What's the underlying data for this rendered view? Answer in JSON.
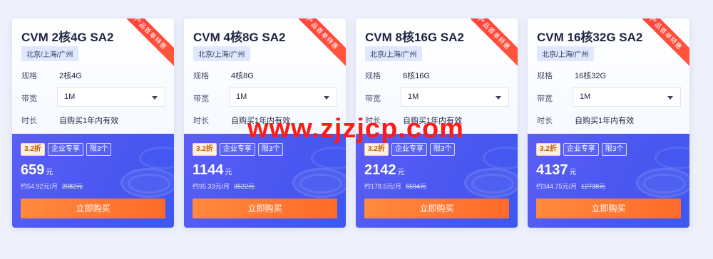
{
  "ribbon_label": "产品首单特惠",
  "labels": {
    "spec": "规格",
    "bandwidth": "带宽",
    "duration": "时长"
  },
  "buy_label": "立即购买",
  "currency_unit": "元",
  "cards": [
    {
      "title": "CVM 2核4G SA2",
      "region": "北京/上海/广州",
      "spec": "2核4G",
      "bandwidth": "1M",
      "duration": "自购买1年内有效",
      "tags": [
        "3.2折",
        "企业专享",
        "限3个"
      ],
      "price": "659",
      "monthly": "约54.92元/月",
      "original": "2082元"
    },
    {
      "title": "CVM 4核8G SA2",
      "region": "北京/上海/广州",
      "spec": "4核8G",
      "bandwidth": "1M",
      "duration": "自购买1年内有效",
      "tags": [
        "3.2折",
        "企业专享",
        "限3个"
      ],
      "price": "1144",
      "monthly": "约95.33元/月",
      "original": "3522元"
    },
    {
      "title": "CVM 8核16G SA2",
      "region": "北京/上海/广州",
      "spec": "8核16G",
      "bandwidth": "1M",
      "duration": "自购买1年内有效",
      "tags": [
        "3.2折",
        "企业专享",
        "限3个"
      ],
      "price": "2142",
      "monthly": "约178.5元/月",
      "original": "6594元"
    },
    {
      "title": "CVM 16核32G SA2",
      "region": "北京/上海/广州",
      "spec": "16核32G",
      "bandwidth": "1M",
      "duration": "自购买1年内有效",
      "tags": [
        "3.2折",
        "企业专享",
        "限3个"
      ],
      "price": "4137",
      "monthly": "约344.75元/月",
      "original": "12738元"
    }
  ],
  "watermark": "www.zjzjcp.com",
  "colors": {
    "accent": "#4a57f0",
    "buy": "#ff7a33",
    "ribbon": "#ff3b3b",
    "watermark": "#ff1a1a"
  }
}
